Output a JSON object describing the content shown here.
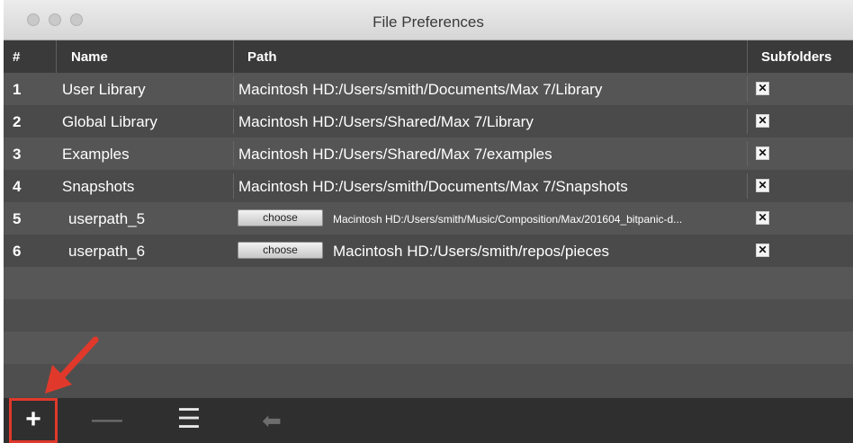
{
  "window": {
    "title": "File Preferences"
  },
  "table": {
    "headers": {
      "num": "#",
      "name": "Name",
      "path": "Path",
      "subfolders": "Subfolders"
    },
    "rows": [
      {
        "num": "1",
        "name": "User Library",
        "path": "Macintosh HD:/Users/smith/Documents/Max 7/Library",
        "subfolders": true
      },
      {
        "num": "2",
        "name": "Global Library",
        "path": "Macintosh HD:/Users/Shared/Max 7/Library",
        "subfolders": true
      },
      {
        "num": "3",
        "name": "Examples",
        "path": "Macintosh HD:/Users/Shared/Max 7/examples",
        "subfolders": true
      },
      {
        "num": "4",
        "name": "Snapshots",
        "path": "Macintosh HD:/Users/smith/Documents/Max 7/Snapshots",
        "subfolders": true
      },
      {
        "num": "5",
        "name": "userpath_5",
        "choose": "choose",
        "path": "Macintosh HD:/Users/smith/Music/Composition/Max/201604_bitpanic-d...",
        "subfolders": true
      },
      {
        "num": "6",
        "name": "userpath_6",
        "choose": "choose",
        "path": "Macintosh HD:/Users/smith/repos/pieces",
        "subfolders": true
      }
    ],
    "checkbox_mark": "✕"
  },
  "toolbar": {
    "add_label": "+",
    "remove_label": "—",
    "list_label": "☰",
    "back_label": "⬅"
  },
  "colors": {
    "highlight": "#e0392b"
  }
}
